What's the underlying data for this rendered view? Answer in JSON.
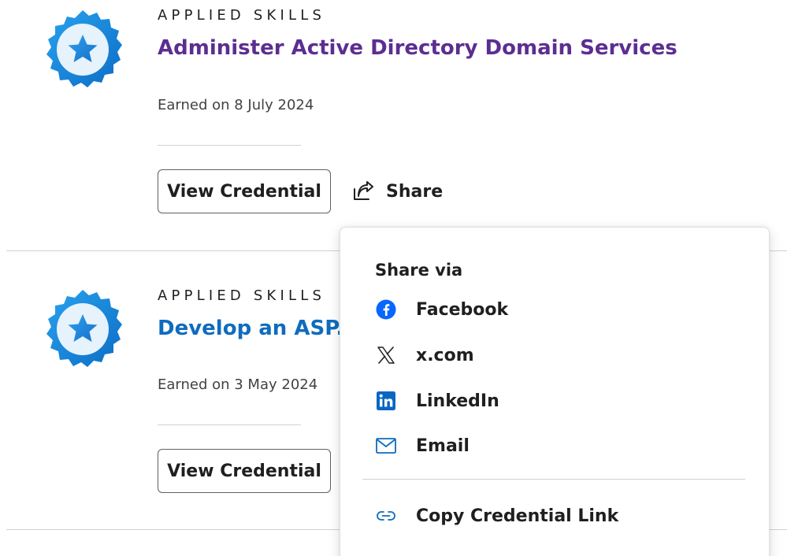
{
  "credentials": [
    {
      "category": "APPLIED SKILLS",
      "title": "Administer Active Directory Domain Services",
      "earned": "Earned on 8 July 2024",
      "view_label": "View Credential",
      "share_label": "Share"
    },
    {
      "category": "APPLIED SKILLS",
      "title": "Develop an ASP.N",
      "earned": "Earned on 3 May 2024",
      "view_label": "View Credential"
    }
  ],
  "share_menu": {
    "heading": "Share via",
    "items": [
      {
        "label": "Facebook",
        "icon": "facebook-icon"
      },
      {
        "label": "x.com",
        "icon": "x-icon"
      },
      {
        "label": "LinkedIn",
        "icon": "linkedin-icon"
      },
      {
        "label": "Email",
        "icon": "mail-icon"
      },
      {
        "label": "Copy Credential Link",
        "icon": "link-icon"
      }
    ]
  },
  "colors": {
    "title_visited": "#5c2e91",
    "title_link": "#0f6cbd",
    "badge_blue": "#1a8fe3",
    "facebook_blue": "#0866ff",
    "linkedin_blue": "#0a66c2",
    "menu_icon_blue": "#0f6cbd"
  }
}
